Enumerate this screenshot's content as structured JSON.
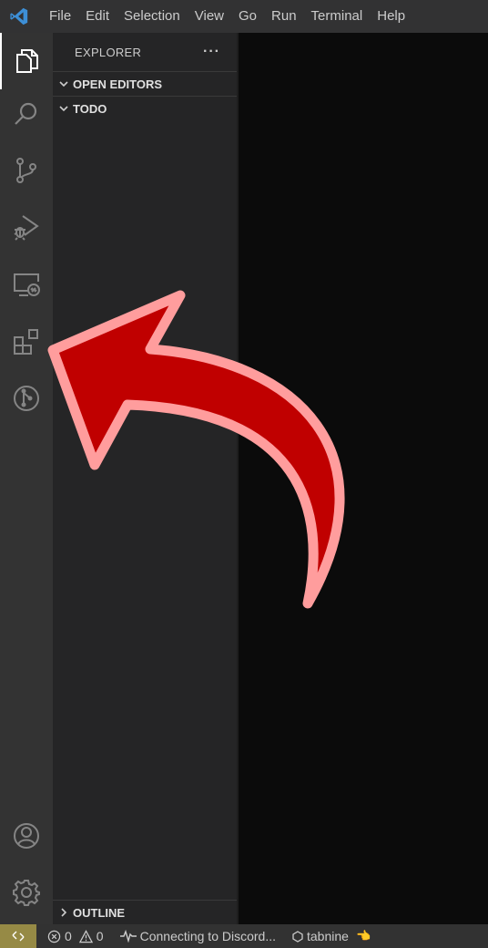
{
  "menu": [
    "File",
    "Edit",
    "Selection",
    "View",
    "Go",
    "Run",
    "Terminal",
    "Help"
  ],
  "sidebar": {
    "title": "EXPLORER",
    "more": "···",
    "sections": [
      {
        "label": "OPEN EDITORS",
        "expanded": true
      },
      {
        "label": "TODO",
        "expanded": true
      }
    ],
    "outline": {
      "label": "OUTLINE",
      "expanded": false
    }
  },
  "activity_bar": {
    "items": [
      "explorer-icon",
      "search-icon",
      "source-control-icon",
      "run-debug-icon",
      "remote-explorer-icon",
      "extensions-icon",
      "git-graph-icon"
    ],
    "bottom": [
      "account-icon",
      "settings-gear-icon"
    ]
  },
  "status": {
    "errors": "0",
    "warnings": "0",
    "discord": "Connecting to Discord...",
    "tabnine": "tabnine",
    "tabnine_emoji": "👈"
  },
  "colors": {
    "arrow_fill": "#c00000",
    "arrow_outline": "#ff9d9d",
    "remote_indicator": "#968a45",
    "vscode_blue": "#3d8fd6"
  }
}
